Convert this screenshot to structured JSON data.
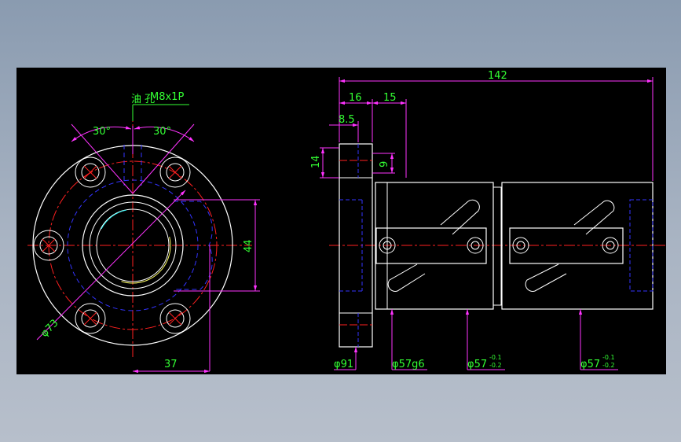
{
  "colors": {
    "background": "#000000",
    "outline": "#ffffff",
    "hidden": "#3333ff",
    "centerline": "#ff2020",
    "dimension": "#ff33ff",
    "text": "#33ff33",
    "thread": "#ffff66",
    "highlight": "#33ffff"
  },
  "front_view": {
    "oil_hole_label": "油 孔",
    "thread_label": "M8x1P",
    "angle_left": "30°",
    "angle_right": "30°",
    "bolt_circle": "φ73",
    "height_dim": "44",
    "width_dim": "37"
  },
  "side_view": {
    "overall_length": "142",
    "flange_width": "16",
    "offset_15": "15",
    "offset_8_5": "8.5",
    "height_14": "14",
    "height_9": "9",
    "flange_dia": "φ91",
    "shaft_dia": "φ57g6",
    "dia_mid": "φ57",
    "dia_mid_tol_upper": "-0.1",
    "dia_mid_tol_lower": "-0.2",
    "dia_right": "φ57",
    "dia_right_tol_upper": "-0.1",
    "dia_right_tol_lower": "-0.2"
  }
}
